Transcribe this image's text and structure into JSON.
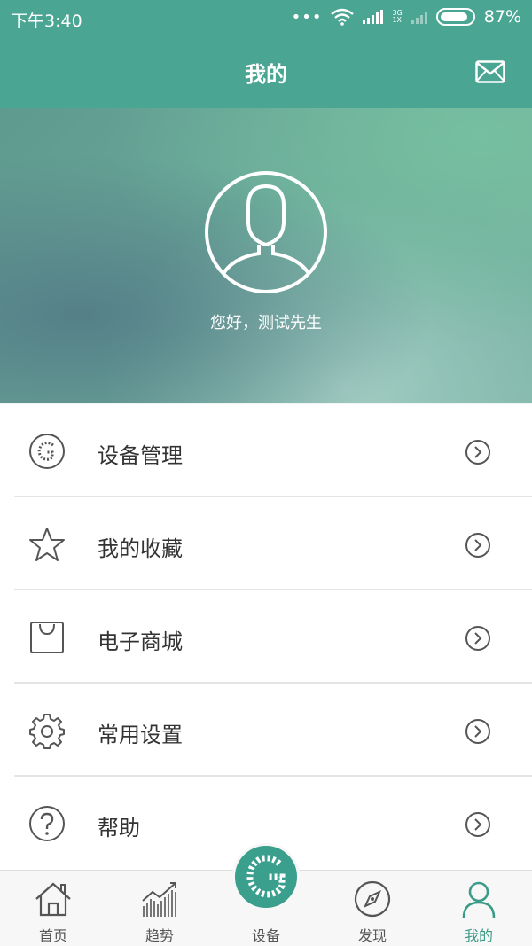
{
  "status_bar": {
    "time": "下午3:40",
    "network_top": "3G",
    "network_bottom": "1X",
    "battery": "87%"
  },
  "header": {
    "title": "我的"
  },
  "profile": {
    "greeting": "您好，测试先生"
  },
  "menu": {
    "items": [
      {
        "label": "设备管理",
        "icon": "device-g-icon"
      },
      {
        "label": "我的收藏",
        "icon": "star-icon"
      },
      {
        "label": "电子商城",
        "icon": "shopping-bag-icon"
      },
      {
        "label": "常用设置",
        "icon": "gear-icon"
      },
      {
        "label": "帮助",
        "icon": "help-icon"
      }
    ]
  },
  "tabbar": {
    "tabs": [
      {
        "label": "首页",
        "icon": "home-icon"
      },
      {
        "label": "趋势",
        "icon": "trend-chart-icon"
      },
      {
        "label": "设备",
        "icon": "device-g-icon"
      },
      {
        "label": "发现",
        "icon": "compass-icon"
      },
      {
        "label": "我的",
        "icon": "person-icon"
      }
    ],
    "active": "我的"
  },
  "colors": {
    "primary": "#4aa593",
    "active_tab": "#3a9b88"
  }
}
